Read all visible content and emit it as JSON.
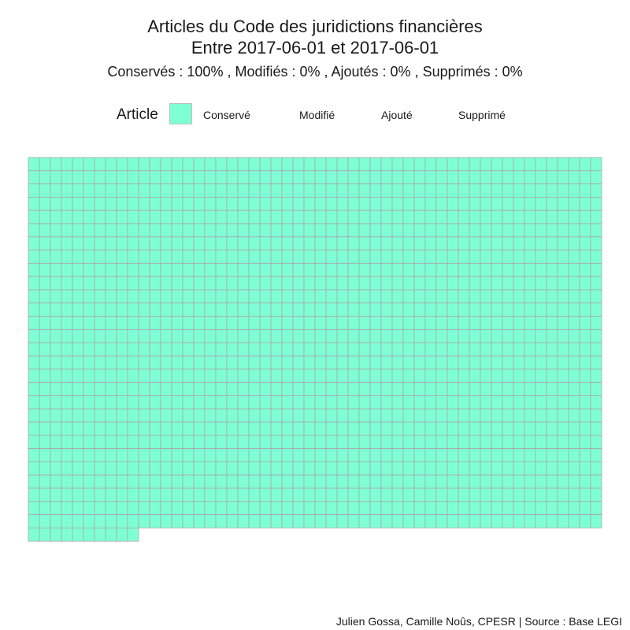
{
  "chart_data": {
    "type": "waffle",
    "title_line1": "Articles du Code des juridictions financières",
    "title_line2": "Entre 2017-06-01 et 2017-06-01",
    "subtitle": "Conservés :  100% , Modifiés :  0% , Ajoutés :  0% , Supprimés :  0%",
    "legend": {
      "title": "Article",
      "items": [
        {
          "label": "Conservé",
          "color": "#7fffd4",
          "count": 1466
        },
        {
          "label": "Modifié",
          "color": "#ffa500",
          "count": 0
        },
        {
          "label": "Ajouté",
          "color": "#00bfff",
          "count": 0
        },
        {
          "label": "Supprimé",
          "color": "#ff6347",
          "count": 0
        }
      ]
    },
    "grid": {
      "columns": 52,
      "rows": 29
    },
    "cell_border_color": "#a9a9a9",
    "caption": "Julien Gossa, Camille Noûs, CPESR  |  Source : Base LEGI"
  }
}
